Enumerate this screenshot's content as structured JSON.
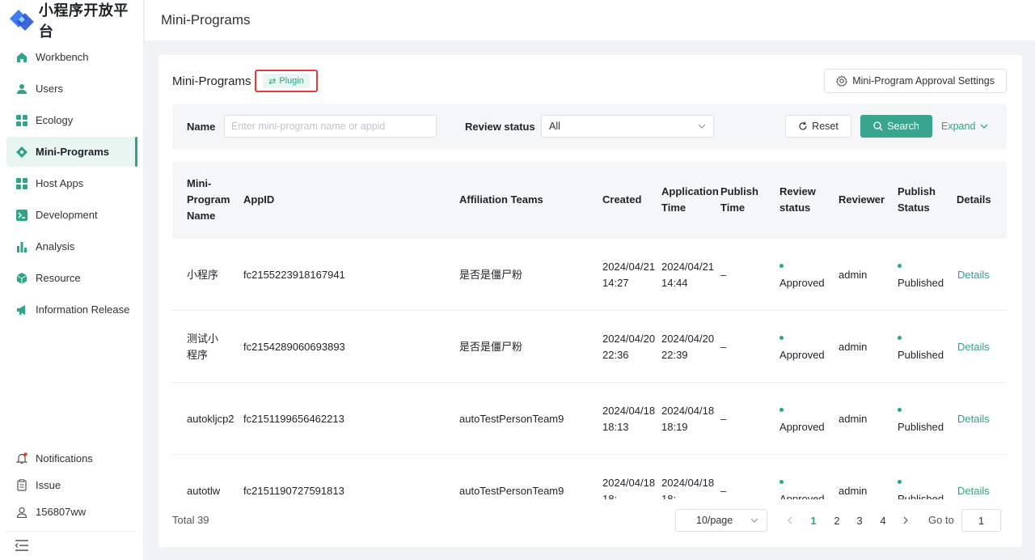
{
  "brand": {
    "title": "小程序开放平台"
  },
  "header": {
    "title": "Mini-Programs"
  },
  "sidebar": {
    "items": [
      {
        "label": "Workbench",
        "icon": "home-icon"
      },
      {
        "label": "Users",
        "icon": "user-icon"
      },
      {
        "label": "Ecology",
        "icon": "grid-icon"
      },
      {
        "label": "Mini-Programs",
        "icon": "diamond-icon",
        "active": true
      },
      {
        "label": "Host Apps",
        "icon": "grid-icon"
      },
      {
        "label": "Development",
        "icon": "terminal-icon"
      },
      {
        "label": "Analysis",
        "icon": "bar-chart-icon"
      },
      {
        "label": "Resource",
        "icon": "cube-icon"
      },
      {
        "label": "Information Release",
        "icon": "megaphone-icon"
      }
    ],
    "bottom": [
      {
        "label": "Notifications",
        "icon": "bell-icon"
      },
      {
        "label": "Issue",
        "icon": "clipboard-icon"
      },
      {
        "label": "156807ww",
        "icon": "user-outline-icon"
      }
    ]
  },
  "card": {
    "title": "Mini-Programs",
    "plugin_label": "Plugin",
    "approval_label": "Mini-Program Approval Settings"
  },
  "filter": {
    "name_label": "Name",
    "name_placeholder": "Enter mini-program name or appid",
    "name_value": "",
    "status_label": "Review status",
    "status_value": "All",
    "reset_label": "Reset",
    "search_label": "Search",
    "expand_label": "Expand"
  },
  "table": {
    "headers": [
      "Mini-Program Name",
      "AppID",
      "Affiliation Teams",
      "Created",
      "Application Time",
      "Publish Time",
      "Review status",
      "Reviewer",
      "Publish Status",
      "Details"
    ],
    "rows": [
      {
        "name": "小程序",
        "appid": "fc2155223918167941",
        "team": "是否是僵尸粉",
        "created": "2024/04/21 14:27",
        "applied": "2024/04/21 14:44",
        "published": "–",
        "review": "Approved",
        "reviewer": "admin",
        "status": "Published",
        "details": "Details"
      },
      {
        "name": "测试小程序",
        "appid": "fc2154289060693893",
        "team": "是否是僵尸粉",
        "created": "2024/04/20 22:36",
        "applied": "2024/04/20 22:39",
        "published": "–",
        "review": "Approved",
        "reviewer": "admin",
        "status": "Published",
        "details": "Details"
      },
      {
        "name": "autokljcp2",
        "appid": "fc2151199656462213",
        "team": "autoTestPersonTeam9",
        "created": "2024/04/18 18:13",
        "applied": "2024/04/18 18:19",
        "published": "–",
        "review": "Approved",
        "reviewer": "admin",
        "status": "Published",
        "details": "Details"
      },
      {
        "name": "autotlw",
        "appid": "fc2151190727591813",
        "team": "autoTestPersonTeam9",
        "created": "2024/04/18 18:",
        "applied": "2024/04/18 18:",
        "published": "–",
        "review": "Approved",
        "reviewer": "admin",
        "status": "Published",
        "details": "Details"
      }
    ]
  },
  "pagination": {
    "total": "Total 39",
    "page_size": "10/page",
    "pages": [
      "1",
      "2",
      "3",
      "4"
    ],
    "current": "1",
    "goto_label": "Go to",
    "goto_value": "1"
  },
  "colors": {
    "accent": "#2ea488",
    "highlight_border": "#e23b3b"
  }
}
